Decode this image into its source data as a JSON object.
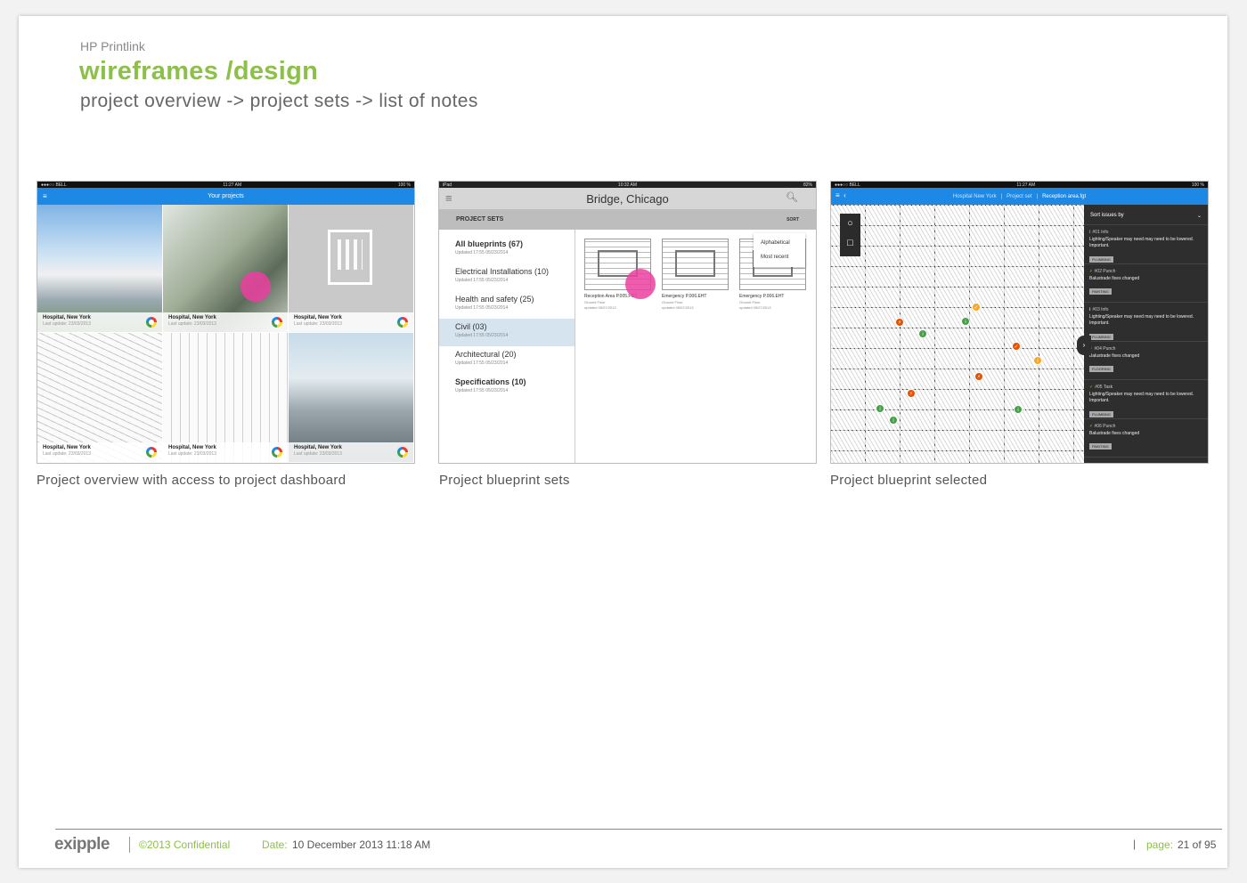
{
  "header": {
    "brand": "HP Printlink",
    "title": "wireframes /design",
    "subtitle": "project overview -> project sets -> list of notes"
  },
  "shot1": {
    "status_left": "●●●○○ BELL",
    "status_time": "11:27 AM",
    "status_right": "100 %",
    "bar_title": "Your projects",
    "tiles": [
      {
        "name": "Hospital, New York",
        "updated": "Last update: 23/03/2013"
      },
      {
        "name": "Hospital, New York",
        "updated": "Last update: 23/03/2013"
      },
      {
        "name": "Hospital, New York",
        "updated": "Last update: 23/03/2013"
      },
      {
        "name": "Hospital, New York",
        "updated": "Last update: 23/03/2013"
      },
      {
        "name": "Hospital, New York",
        "updated": "Last update: 23/03/2013"
      },
      {
        "name": "Hospital, New York",
        "updated": "Last update: 23/03/2013"
      }
    ],
    "caption": "Project overview with access to project dashboard"
  },
  "shot2": {
    "status_left": "iPad",
    "status_time": "10:32 AM",
    "status_right": "82%",
    "header": "Bridge, Chicago",
    "sets_label": "PROJECT SETS",
    "sort_label": "SORT",
    "sort_options": [
      "Alphabetical",
      "Most recent"
    ],
    "sets": [
      {
        "name": "All blueprints (67)",
        "updated": "Updated 17:55 05/23/2014"
      },
      {
        "name": "Electrical Installations (10)",
        "updated": "Updated 17:55 05/23/2014"
      },
      {
        "name": "Health and safety (25)",
        "updated": "Updated 17:55 05/23/2014"
      },
      {
        "name": "Civil (03)",
        "updated": "Updated 17:55 05/23/2014"
      },
      {
        "name": "Architectural (20)",
        "updated": "Updated 17:55 05/23/2014"
      },
      {
        "name": "Specifications (10)",
        "updated": "Updated 17:55 05/23/2014"
      }
    ],
    "blueprints": [
      {
        "name": "Reception Area P.005.FGT",
        "floor": "Ground Floor",
        "updated": "updated 05/07/2013"
      },
      {
        "name": "Emergency P.006.EHT",
        "floor": "Ground Floor",
        "updated": "updated 05/07/2013"
      },
      {
        "name": "Emergency P.006.EHT",
        "floor": "Ground Floor",
        "updated": "updated 05/07/2013"
      }
    ],
    "caption": "Project blueprint sets"
  },
  "shot3": {
    "status_left": "●●●○○ BELL",
    "status_time": "11:27 AM",
    "status_right": "100 %",
    "crumbs": [
      "Hospital New York",
      "Project set",
      "Reception area.fgt"
    ],
    "panel_title": "Sort issues by",
    "issues": [
      {
        "icon": "i",
        "num": "#01 Info",
        "text": "Lighting/Speaker may need may need to be lowered. Important.",
        "tag": "PLUMBING",
        "color": "#8cc049"
      },
      {
        "icon": "⚡",
        "num": "#02 Punch",
        "text": "Balustrade fixes changed",
        "tag": "PAINTING",
        "color": "#8cc049"
      },
      {
        "icon": "i",
        "num": "#03 Info",
        "text": "Lighting/Speaker may need may need to be lowered. Important.",
        "tag": "PLUMBING",
        "color": "#fdd835"
      },
      {
        "icon": "⚡",
        "num": "#04 Punch",
        "text": "Balustrade fixes changed",
        "tag": "FLOORING",
        "color": "#8cc049"
      },
      {
        "icon": "✓",
        "num": "#05 Task",
        "text": "Lighting/Speaker may need may need to be lowered. Important.",
        "tag": "PLUMBING",
        "color": "#8cc049"
      },
      {
        "icon": "⚡",
        "num": "#06 Punch",
        "text": "Balustrade fixes changed",
        "tag": "PAINTING",
        "color": "#8cc049"
      }
    ],
    "caption": "Project blueprint selected"
  },
  "footer": {
    "logo": "exipple",
    "confidential": "©2013 Confidential",
    "date_label": "Date:",
    "date": "10 December 2013 11:18 AM",
    "bar": "|",
    "page_label": "page:",
    "page": "21 of 95"
  },
  "colors": {
    "accent": "#8cc049",
    "blue": "#1e88e5",
    "touch": "#ec40a0"
  }
}
